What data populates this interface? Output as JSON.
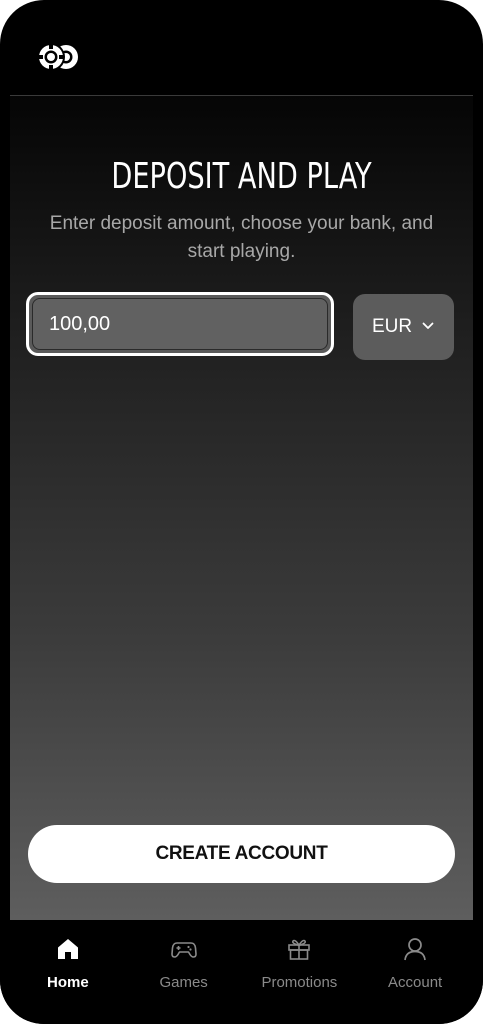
{
  "colors": {
    "background": "#000000",
    "primary_button": "#ffffff",
    "input_border_active": "#ffffff",
    "nav_inactive": "#8a8a8a",
    "nav_active": "#ffffff"
  },
  "header": {
    "logo_icon": "poker-chips-logo-icon"
  },
  "main": {
    "title": "DEPOSIT AND PLAY",
    "subtitle": "Enter deposit amount, choose your bank, and start playing.",
    "amount": {
      "value": "100,00",
      "placeholder": ""
    },
    "currency": {
      "selected": "EUR",
      "icon": "chevron-down-icon"
    },
    "create_account_label": "CREATE ACCOUNT"
  },
  "bottom_nav": {
    "items": [
      {
        "label": "Home",
        "icon": "home-icon",
        "active": true
      },
      {
        "label": "Games",
        "icon": "gamepad-icon",
        "active": false
      },
      {
        "label": "Promotions",
        "icon": "gift-icon",
        "active": false
      },
      {
        "label": "Account",
        "icon": "user-icon",
        "active": false
      }
    ]
  }
}
